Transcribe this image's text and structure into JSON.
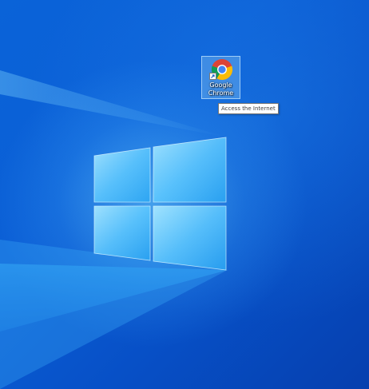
{
  "desktop": {
    "icons": [
      {
        "label": "Google Chrome",
        "icon": "chrome-icon",
        "shortcut_overlay": "shortcut-arrow-icon"
      }
    ],
    "tooltip": "Access the Internet"
  },
  "wallpaper": {
    "logo": "windows-logo",
    "colors": {
      "background": "#0a63d8",
      "logo_glow": "#6fd0ff"
    }
  }
}
